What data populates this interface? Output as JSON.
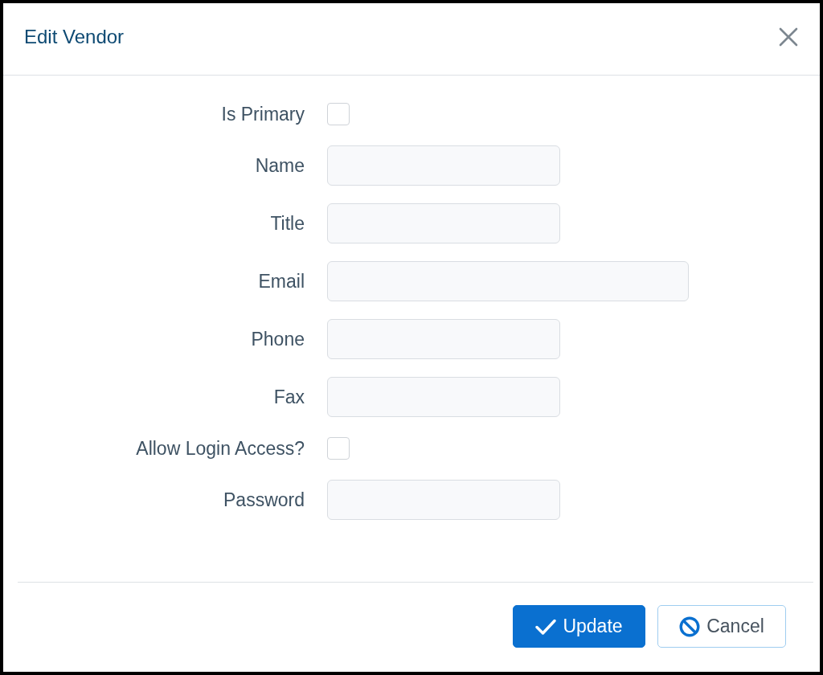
{
  "dialog": {
    "title": "Edit Vendor"
  },
  "fields": [
    {
      "label": "Is Primary",
      "kind": "checkbox",
      "checked": false
    },
    {
      "label": "Name",
      "kind": "text",
      "wide": false
    },
    {
      "label": "Title",
      "kind": "text",
      "wide": false
    },
    {
      "label": "Email",
      "kind": "text",
      "wide": true
    },
    {
      "label": "Phone",
      "kind": "text",
      "wide": false
    },
    {
      "label": "Fax",
      "kind": "text",
      "wide": false
    },
    {
      "label": "Allow Login Access?",
      "kind": "checkbox",
      "checked": false
    },
    {
      "label": "Password",
      "kind": "text",
      "wide": false
    }
  ],
  "buttons": [
    {
      "label": "Update",
      "kind": "primary"
    },
    {
      "label": "Cancel",
      "kind": "secondary"
    }
  ]
}
